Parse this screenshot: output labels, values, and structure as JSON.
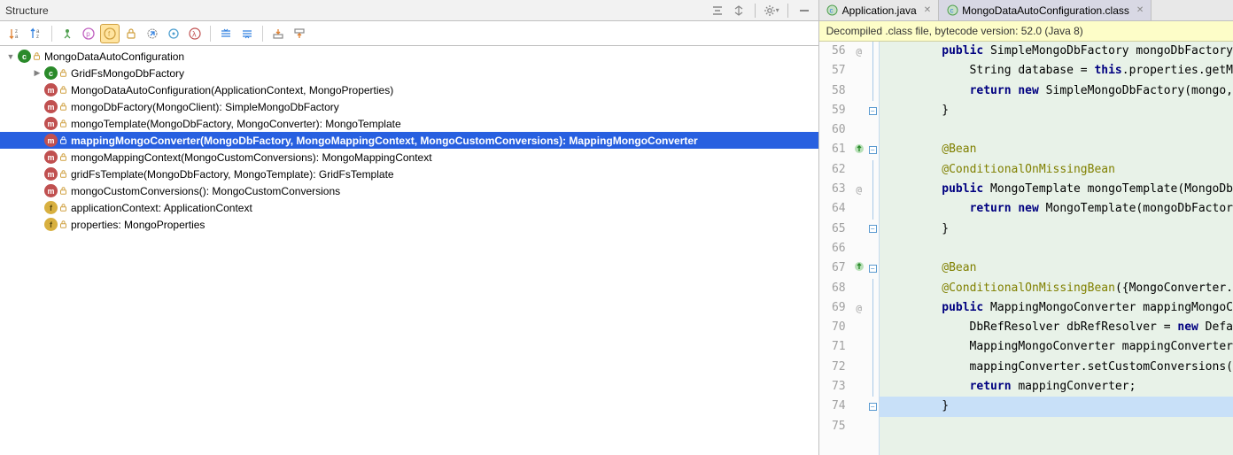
{
  "panel": {
    "title": "Structure"
  },
  "tree": {
    "root": {
      "label": "MongoDataAutoConfiguration"
    },
    "items": [
      {
        "label": "GridFsMongoDbFactory",
        "kind": "class",
        "indent": 1,
        "hasArrow": true
      },
      {
        "label": "MongoDataAutoConfiguration(ApplicationContext, MongoProperties)",
        "kind": "method",
        "indent": 1
      },
      {
        "label": "mongoDbFactory(MongoClient): SimpleMongoDbFactory",
        "kind": "method",
        "indent": 1
      },
      {
        "label": "mongoTemplate(MongoDbFactory, MongoConverter): MongoTemplate",
        "kind": "method",
        "indent": 1
      },
      {
        "label": "mappingMongoConverter(MongoDbFactory, MongoMappingContext, MongoCustomConversions): MappingMongoConverter",
        "kind": "method",
        "indent": 1,
        "selected": true
      },
      {
        "label": "mongoMappingContext(MongoCustomConversions): MongoMappingContext",
        "kind": "method",
        "indent": 1
      },
      {
        "label": "gridFsTemplate(MongoDbFactory, MongoTemplate): GridFsTemplate",
        "kind": "method",
        "indent": 1
      },
      {
        "label": "mongoCustomConversions(): MongoCustomConversions",
        "kind": "method",
        "indent": 1
      },
      {
        "label": "applicationContext: ApplicationContext",
        "kind": "field",
        "indent": 1
      },
      {
        "label": "properties: MongoProperties",
        "kind": "field",
        "indent": 1
      }
    ]
  },
  "tabs": [
    {
      "label": "Application.java",
      "active": false
    },
    {
      "label": "MongoDataAutoConfiguration.class",
      "active": true
    }
  ],
  "banner": "Decompiled .class file, bytecode version: 52.0 (Java 8)",
  "code": {
    "startLine": 56,
    "lines": [
      {
        "n": 56,
        "ann": "@",
        "fold": "line",
        "html": "<span class='kw'>public</span> SimpleMongoDbFactory mongoDbFactory",
        "indent": 2
      },
      {
        "n": 57,
        "fold": "line",
        "html": "String database = <span class='this'>this</span>.properties.getM",
        "indent": 3
      },
      {
        "n": 58,
        "fold": "line",
        "html": "<span class='ret'>return new</span> SimpleMongoDbFactory(mongo,",
        "indent": 3
      },
      {
        "n": 59,
        "fold": "close",
        "html": "}",
        "indent": 2
      },
      {
        "n": 60,
        "html": "",
        "indent": 0
      },
      {
        "n": 61,
        "ann": "override",
        "fold": "open",
        "html": "<span class='ann-txt'>@Bean</span>",
        "indent": 2
      },
      {
        "n": 62,
        "fold": "line",
        "html": "<span class='ann-txt'>@ConditionalOnMissingBean</span>",
        "indent": 2
      },
      {
        "n": 63,
        "ann": "@",
        "fold": "line",
        "html": "<span class='kw'>public</span> MongoTemplate mongoTemplate(MongoDb",
        "indent": 2
      },
      {
        "n": 64,
        "fold": "line",
        "html": "<span class='ret'>return new</span> MongoTemplate(mongoDbFactor",
        "indent": 3
      },
      {
        "n": 65,
        "fold": "close",
        "html": "}",
        "indent": 2
      },
      {
        "n": 66,
        "html": "",
        "indent": 0
      },
      {
        "n": 67,
        "ann": "override",
        "fold": "open",
        "html": "<span class='ann-txt'>@Bean</span>",
        "indent": 2
      },
      {
        "n": 68,
        "fold": "line",
        "html": "<span class='ann-txt'>@ConditionalOnMissingBean</span>({MongoConverter.",
        "indent": 2
      },
      {
        "n": 69,
        "ann": "@",
        "fold": "line",
        "html": "<span class='kw'>public</span> MappingMongoConverter mappingMongoC",
        "indent": 2
      },
      {
        "n": 70,
        "fold": "line",
        "html": "DbRefResolver dbRefResolver = <span class='kw'>new</span> Defa",
        "indent": 3
      },
      {
        "n": 71,
        "fold": "line",
        "html": "MappingMongoConverter mappingConverter",
        "indent": 3
      },
      {
        "n": 72,
        "fold": "line",
        "html": "mappingConverter.setCustomConversions(",
        "indent": 3
      },
      {
        "n": 73,
        "fold": "line",
        "html": "<span class='ret'>return</span> mappingConverter;",
        "indent": 3
      },
      {
        "n": 74,
        "fold": "close",
        "html": "}",
        "indent": 2,
        "highlight": true
      },
      {
        "n": 75,
        "html": "",
        "indent": 0
      }
    ]
  }
}
